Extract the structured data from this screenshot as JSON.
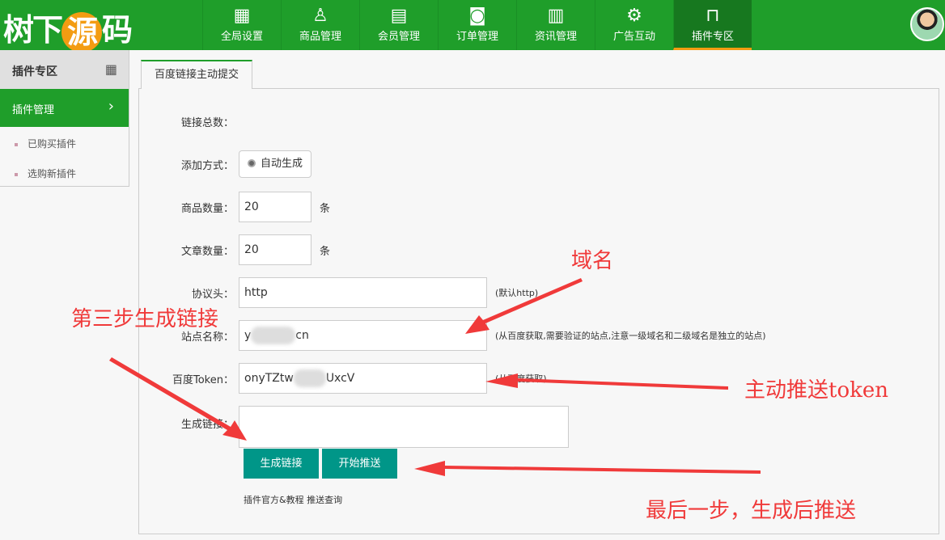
{
  "header": {
    "logo_text": "源码",
    "logo_parts": [
      "树",
      "下",
      "源",
      "码"
    ],
    "nav": [
      {
        "label": "全局设置",
        "icon": "grid-icon"
      },
      {
        "label": "商品管理",
        "icon": "user-icon"
      },
      {
        "label": "会员管理",
        "icon": "document-icon"
      },
      {
        "label": "订单管理",
        "icon": "camera-icon"
      },
      {
        "label": "资讯管理",
        "icon": "calendar-icon"
      },
      {
        "label": "广告互动",
        "icon": "gear-icon"
      },
      {
        "label": "插件专区",
        "icon": "bag-icon",
        "active": true
      }
    ]
  },
  "sidebar": {
    "title": "插件专区",
    "active": "插件管理",
    "items": [
      "已购买插件",
      "选购新插件"
    ]
  },
  "tab": "百度链接主动提交",
  "form": {
    "total_label": "链接总数：",
    "method_label": "添加方式：",
    "method_option": "自动生成",
    "goods_label": "商品数量：",
    "goods_value": "20",
    "goods_unit": "条",
    "article_label": "文章数量：",
    "article_value": "20",
    "article_unit": "条",
    "protocol_label": "协议头：",
    "protocol_value": "http",
    "protocol_hint": "(默认http)",
    "site_label": "站点名称：",
    "site_prefix": "y",
    "site_suffix": "cn",
    "site_hint": "(从百度获取,需要验证的站点,注意一级域名和二级域名是独立的站点)",
    "token_label": "百度Token：",
    "token_prefix": "onyTZtw",
    "token_suffix": "UxcV",
    "token_hint": "(从百度获取)",
    "gen_label": "生成链接：",
    "btn_generate": "生成链接",
    "btn_push": "开始推送",
    "footer": "插件官方&教程 推送查询"
  },
  "annotations": {
    "domain": "域名",
    "step3": "第三步生成链接",
    "token": "主动推送token",
    "last": "最后一步，生成后推送",
    "color": "#f03a3a"
  }
}
